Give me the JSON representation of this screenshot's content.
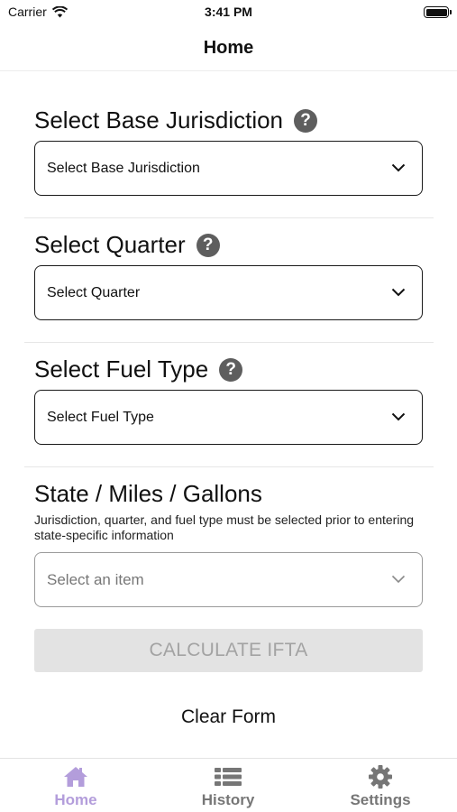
{
  "status_bar": {
    "carrier": "Carrier",
    "time": "3:41 PM"
  },
  "nav": {
    "title": "Home"
  },
  "base_jurisdiction": {
    "label": "Select Base Jurisdiction",
    "value": "Select Base Jurisdiction"
  },
  "quarter": {
    "label": "Select Quarter",
    "value": "Select Quarter"
  },
  "fuel_type": {
    "label": "Select Fuel Type",
    "value": "Select Fuel Type"
  },
  "state_miles": {
    "label": "State / Miles / Gallons",
    "helper": "Jurisdiction, quarter, and fuel type must be selected prior to entering state-specific information",
    "placeholder": "Select an item"
  },
  "actions": {
    "calculate": "CALCULATE IFTA",
    "clear": "Clear Form"
  },
  "tabs": [
    {
      "label": "Home",
      "icon": "home-icon",
      "active": true
    },
    {
      "label": "History",
      "icon": "list-icon",
      "active": false
    },
    {
      "label": "Settings",
      "icon": "gear-icon",
      "active": false
    }
  ],
  "colors": {
    "active_tab": "#b39ddb",
    "inactive_tab": "#767676",
    "help_icon": "#5e5e5e",
    "disabled_button": "#e3e3e3"
  }
}
